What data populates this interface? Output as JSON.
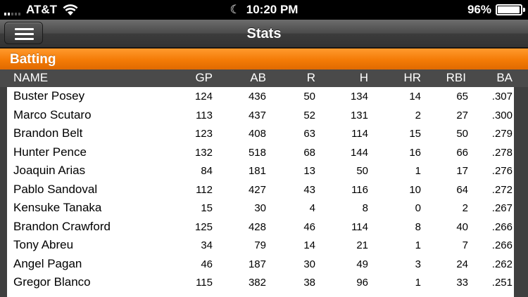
{
  "status_bar": {
    "carrier": "AT&T",
    "time": "10:20 PM",
    "battery_percent": "96%",
    "battery_level": 0.96,
    "icons": [
      "signal-icon",
      "wifi-icon",
      "moon-icon",
      "battery-icon"
    ]
  },
  "nav": {
    "title": "Stats",
    "menu_icon": "hamburger-menu-icon"
  },
  "section": {
    "title": "Batting"
  },
  "table": {
    "columns": [
      "NAME",
      "GP",
      "AB",
      "R",
      "H",
      "HR",
      "RBI",
      "BA"
    ],
    "rows": [
      [
        "Buster Posey",
        "124",
        "436",
        "50",
        "134",
        "14",
        "65",
        ".307"
      ],
      [
        "Marco Scutaro",
        "113",
        "437",
        "52",
        "131",
        "2",
        "27",
        ".300"
      ],
      [
        "Brandon Belt",
        "123",
        "408",
        "63",
        "114",
        "15",
        "50",
        ".279"
      ],
      [
        "Hunter Pence",
        "132",
        "518",
        "68",
        "144",
        "16",
        "66",
        ".278"
      ],
      [
        "Joaquin Arias",
        "84",
        "181",
        "13",
        "50",
        "1",
        "17",
        ".276"
      ],
      [
        "Pablo Sandoval",
        "112",
        "427",
        "43",
        "116",
        "10",
        "64",
        ".272"
      ],
      [
        "Kensuke Tanaka",
        "15",
        "30",
        "4",
        "8",
        "0",
        "2",
        ".267"
      ],
      [
        "Brandon Crawford",
        "125",
        "428",
        "46",
        "114",
        "8",
        "40",
        ".266"
      ],
      [
        "Tony Abreu",
        "34",
        "79",
        "14",
        "21",
        "1",
        "7",
        ".266"
      ],
      [
        "Angel Pagan",
        "46",
        "187",
        "30",
        "49",
        "3",
        "24",
        ".262"
      ],
      [
        "Gregor Blanco",
        "115",
        "382",
        "38",
        "96",
        "1",
        "33",
        ".251"
      ]
    ]
  },
  "colors": {
    "accent_orange": "#f47b06",
    "nav_gray": "#4a4a4a",
    "table_bg": "#ffffff"
  }
}
